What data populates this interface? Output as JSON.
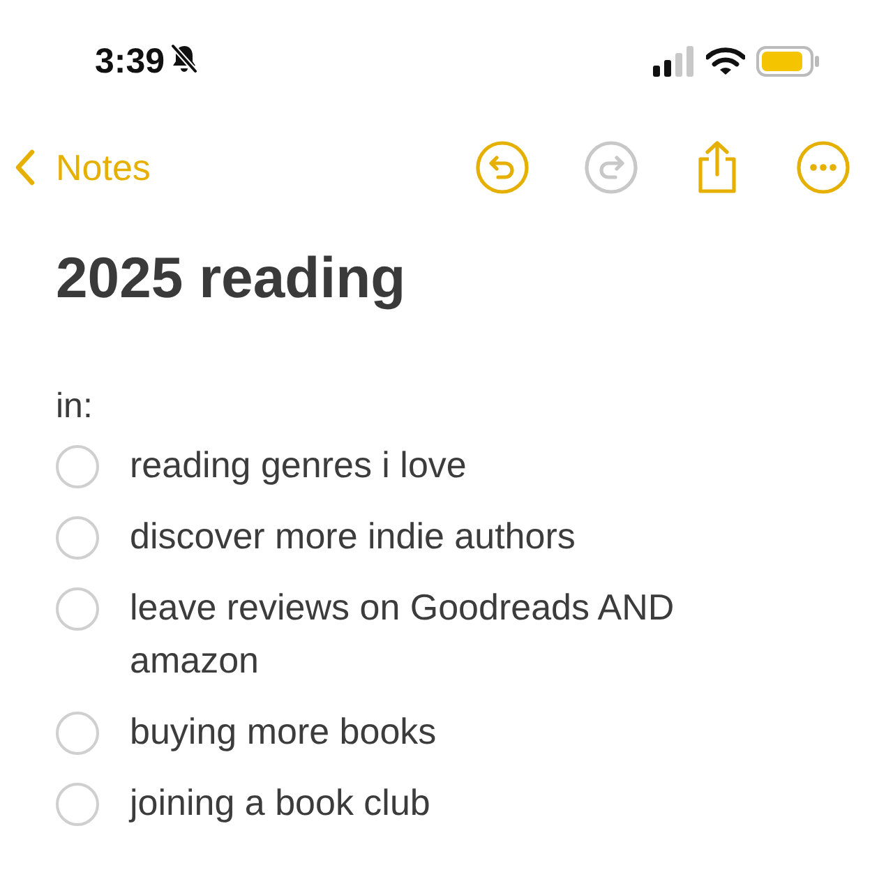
{
  "status_bar": {
    "time": "3:39",
    "silent": true
  },
  "nav": {
    "back_label": "Notes",
    "undo_disabled": false,
    "redo_disabled": true
  },
  "note": {
    "title": "2025 reading",
    "intro": "in:",
    "checklist": [
      {
        "text": "reading genres i love",
        "checked": false
      },
      {
        "text": "discover more indie authors",
        "checked": false
      },
      {
        "text": "leave reviews on Goodreads AND amazon",
        "checked": false
      },
      {
        "text": "buying more books",
        "checked": false
      },
      {
        "text": "joining a book club",
        "checked": false
      }
    ]
  }
}
